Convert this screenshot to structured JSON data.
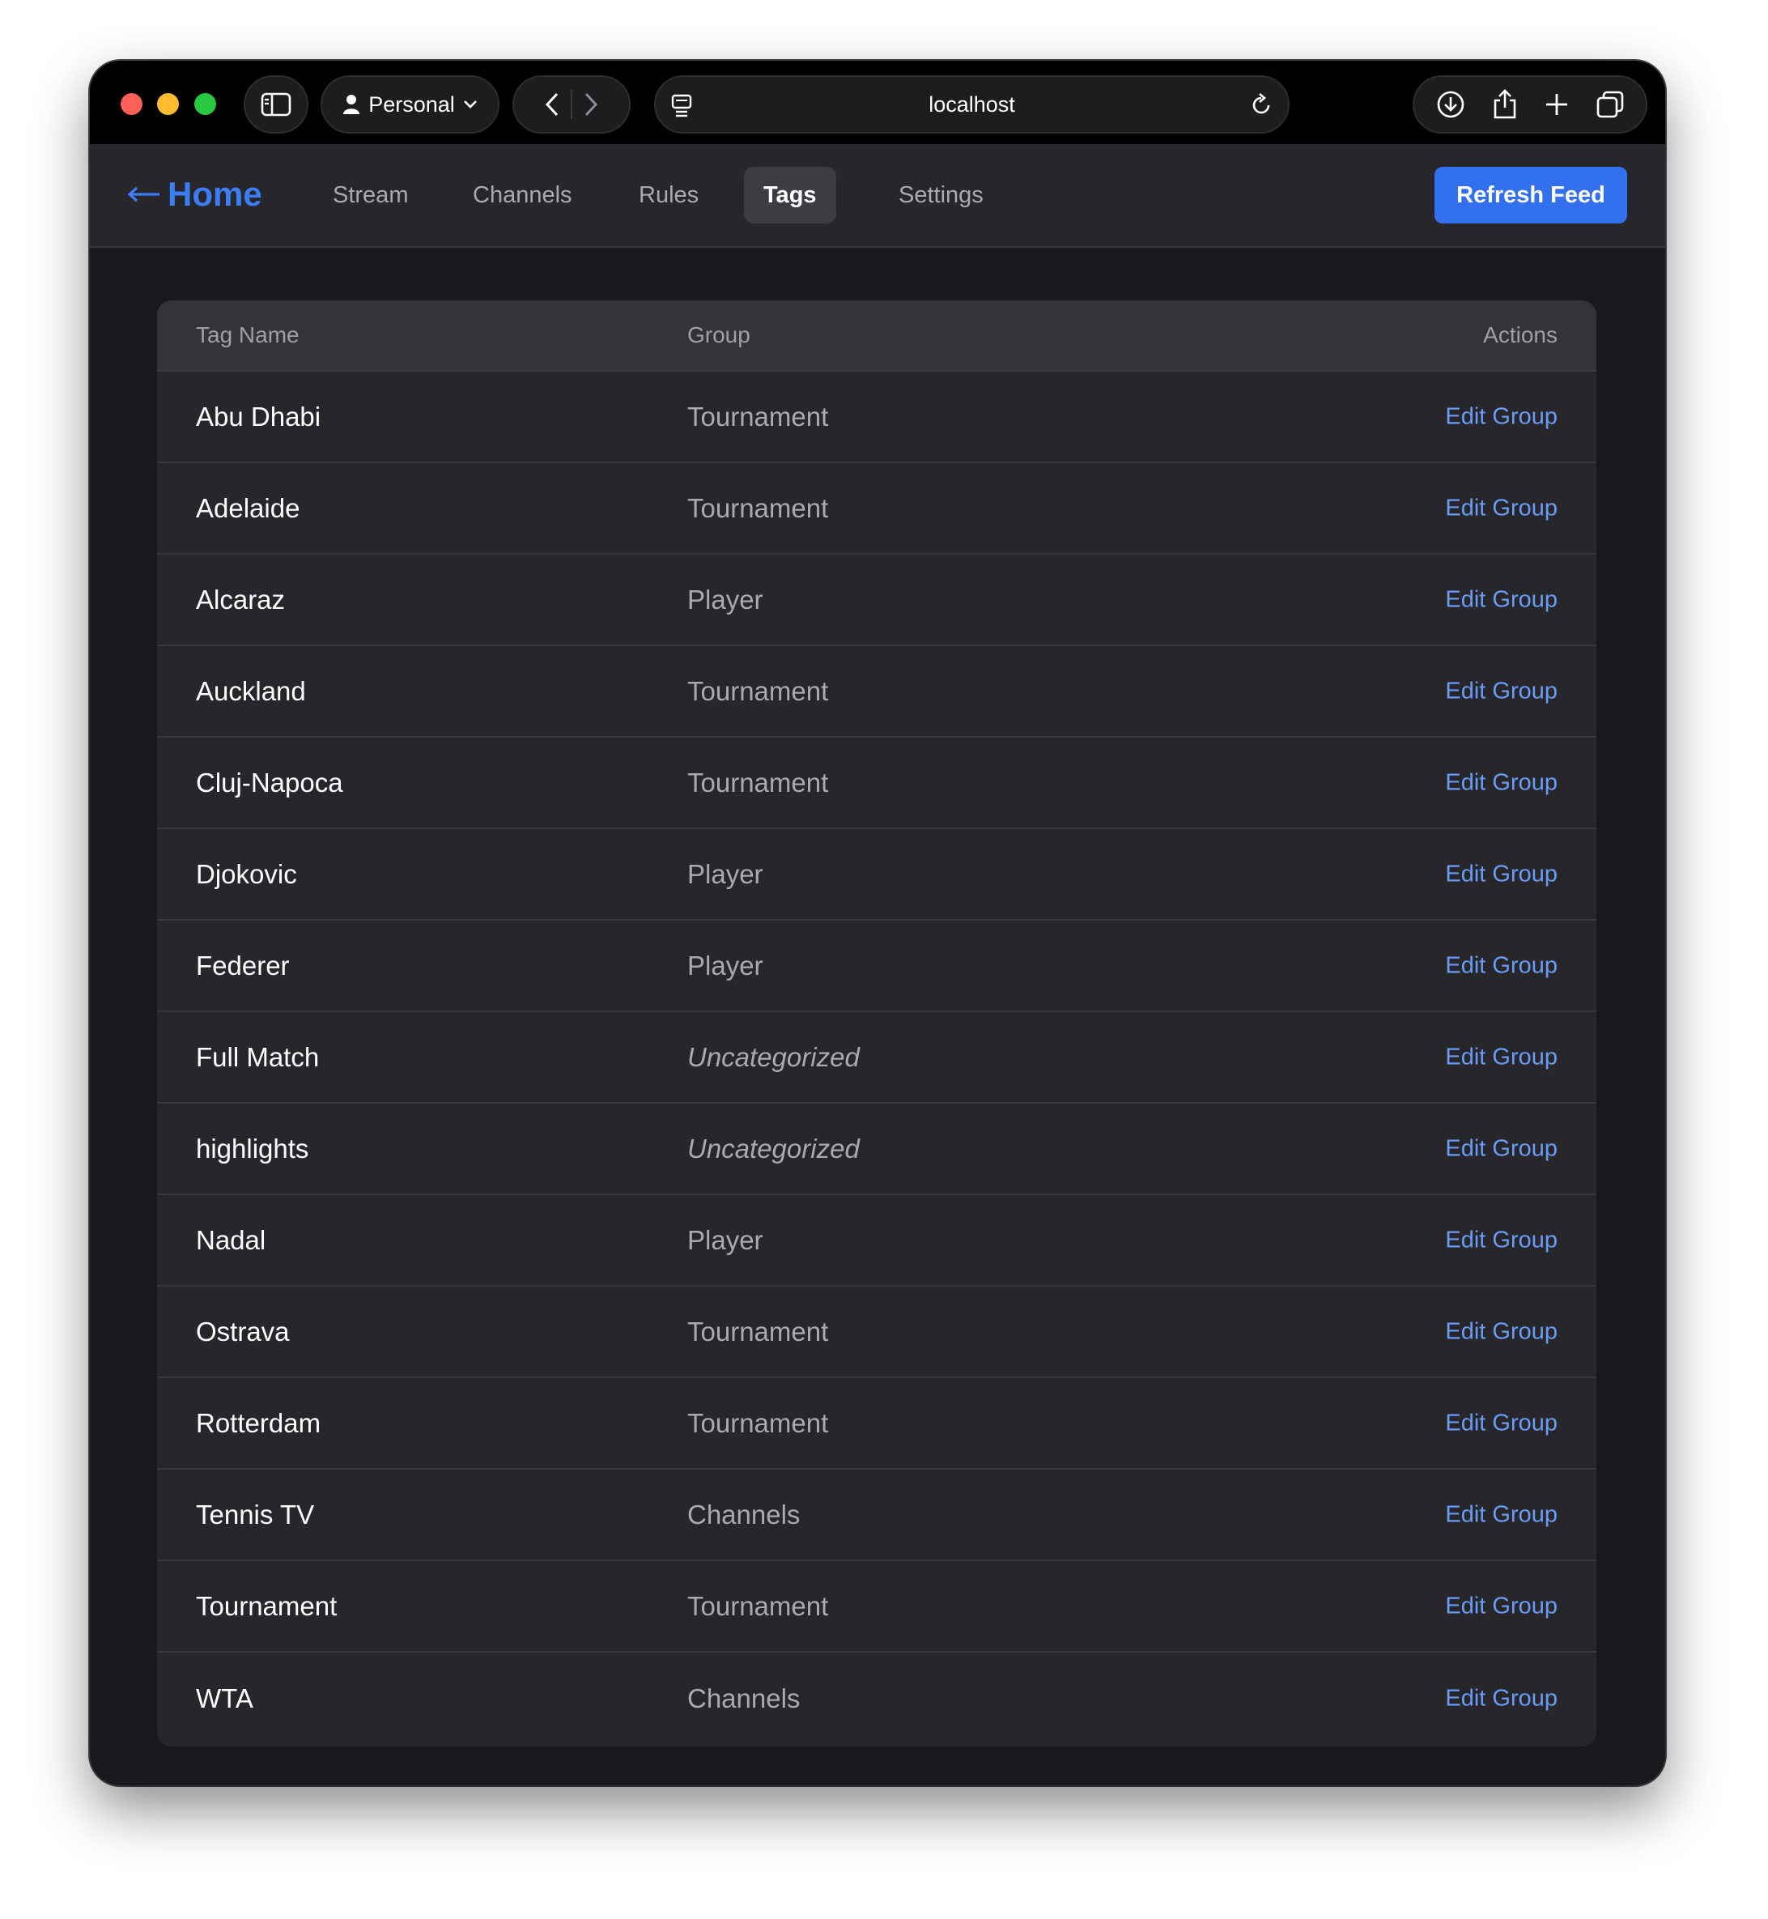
{
  "browser": {
    "profile_label": "Personal",
    "url": "localhost"
  },
  "navbar": {
    "home_label": "Home",
    "items": [
      {
        "label": "Stream"
      },
      {
        "label": "Channels"
      },
      {
        "label": "Rules"
      },
      {
        "label": "Tags",
        "active": true
      },
      {
        "label": "Settings"
      }
    ],
    "refresh_label": "Refresh Feed"
  },
  "table": {
    "headers": {
      "name": "Tag Name",
      "group": "Group",
      "actions": "Actions"
    },
    "rows": [
      {
        "name": "Abu Dhabi",
        "group": "Tournament",
        "action": "Edit Group"
      },
      {
        "name": "Adelaide",
        "group": "Tournament",
        "action": "Edit Group"
      },
      {
        "name": "Alcaraz",
        "group": "Player",
        "action": "Edit Group"
      },
      {
        "name": "Auckland",
        "group": "Tournament",
        "action": "Edit Group"
      },
      {
        "name": "Cluj-Napoca",
        "group": "Tournament",
        "action": "Edit Group"
      },
      {
        "name": "Djokovic",
        "group": "Player",
        "action": "Edit Group"
      },
      {
        "name": "Federer",
        "group": "Player",
        "action": "Edit Group"
      },
      {
        "name": "Full Match",
        "group": "Uncategorized",
        "uncategorized": true,
        "action": "Edit Group"
      },
      {
        "name": "highlights",
        "group": "Uncategorized",
        "uncategorized": true,
        "action": "Edit Group"
      },
      {
        "name": "Nadal",
        "group": "Player",
        "action": "Edit Group"
      },
      {
        "name": "Ostrava",
        "group": "Tournament",
        "action": "Edit Group"
      },
      {
        "name": "Rotterdam",
        "group": "Tournament",
        "action": "Edit Group"
      },
      {
        "name": "Tennis TV",
        "group": "Channels",
        "action": "Edit Group"
      },
      {
        "name": "Tournament",
        "group": "Tournament",
        "action": "Edit Group"
      },
      {
        "name": "WTA",
        "group": "Channels",
        "action": "Edit Group"
      }
    ]
  },
  "colors": {
    "accent": "#3370ee",
    "link": "#6b9cf5",
    "home": "#3b7df6"
  }
}
